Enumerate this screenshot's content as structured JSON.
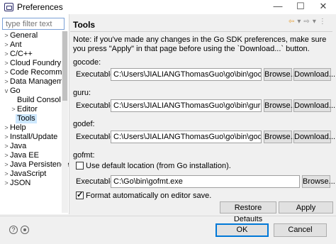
{
  "window": {
    "title": "Preferences"
  },
  "filter": {
    "placeholder": "type filter text"
  },
  "tree": [
    {
      "label": "General",
      "chevron": ">"
    },
    {
      "label": "Ant",
      "chevron": ">"
    },
    {
      "label": "C/C++",
      "chevron": ">"
    },
    {
      "label": "Cloud Foundry",
      "chevron": ">"
    },
    {
      "label": "Code Recomm",
      "chevron": ">"
    },
    {
      "label": "Data Managem",
      "chevron": ">"
    },
    {
      "label": "Go",
      "chevron": "v"
    },
    {
      "label": "Build Consol",
      "chevron": ""
    },
    {
      "label": "Editor",
      "chevron": ">"
    },
    {
      "label": "Tools",
      "chevron": "",
      "selected": true
    },
    {
      "label": "Help",
      "chevron": ">"
    },
    {
      "label": "Install/Update",
      "chevron": ">"
    },
    {
      "label": "Java",
      "chevron": ">"
    },
    {
      "label": "Java EE",
      "chevron": ">"
    },
    {
      "label": "Java Persistence",
      "chevron": ">"
    },
    {
      "label": "JavaScript",
      "chevron": ">"
    },
    {
      "label": "JSON",
      "chevron": ">"
    }
  ],
  "page": {
    "title": "Tools",
    "note": "Note: if you've made any changes in the Go SDK preferences, make sure you press \"Apply\" in that page before using the `Download...` button.",
    "executable_label": "Executable:",
    "browse_label": "Browse...",
    "download_label": "Download...",
    "tools": [
      {
        "name": "gocode:",
        "path": "C:\\Users\\JIALIANGThomasGuo\\go\\bin\\gocode.exe"
      },
      {
        "name": "guru:",
        "path": "C:\\Users\\JIALIANGThomasGuo\\go\\bin\\guru.exe"
      },
      {
        "name": "godef:",
        "path": "C:\\Users\\JIALIANGThomasGuo\\go\\bin\\godef.exe"
      }
    ],
    "gofmt": {
      "name": "gofmt:",
      "use_default_label": "Use default location (from Go installation).",
      "use_default_checked": false,
      "path": "C:\\Go\\bin\\gofmt.exe",
      "format_label": "Format automatically on editor save.",
      "format_checked": true
    },
    "restore_defaults": "Restore Defaults",
    "apply": "Apply"
  },
  "footer": {
    "ok": "OK",
    "cancel": "Cancel"
  }
}
